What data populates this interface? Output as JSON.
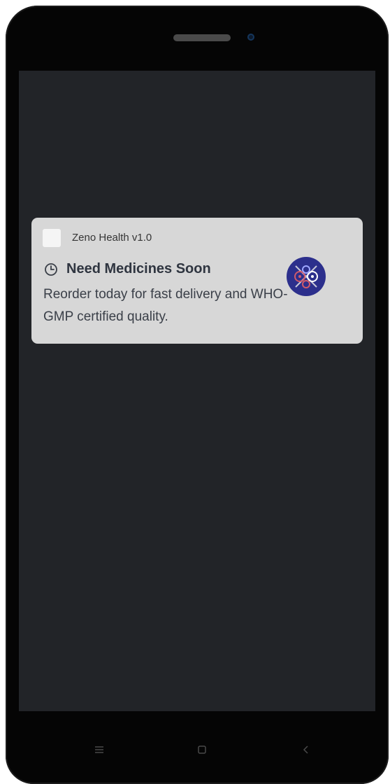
{
  "notification": {
    "app_name": "Zeno Health v1.0",
    "title": "Need Medicines Soon",
    "body": "Reorder today for fast delivery and WHO-GMP certified quality.",
    "title_icon": "clock-icon",
    "large_icon": "zeno-health-logo"
  },
  "nav_bar": {
    "items": [
      "menu-icon",
      "home-icon",
      "back-icon"
    ]
  },
  "colors": {
    "screen_background": "#222428",
    "notification_background": "#d7d7d7",
    "logo_background": "#2c2f8c"
  }
}
